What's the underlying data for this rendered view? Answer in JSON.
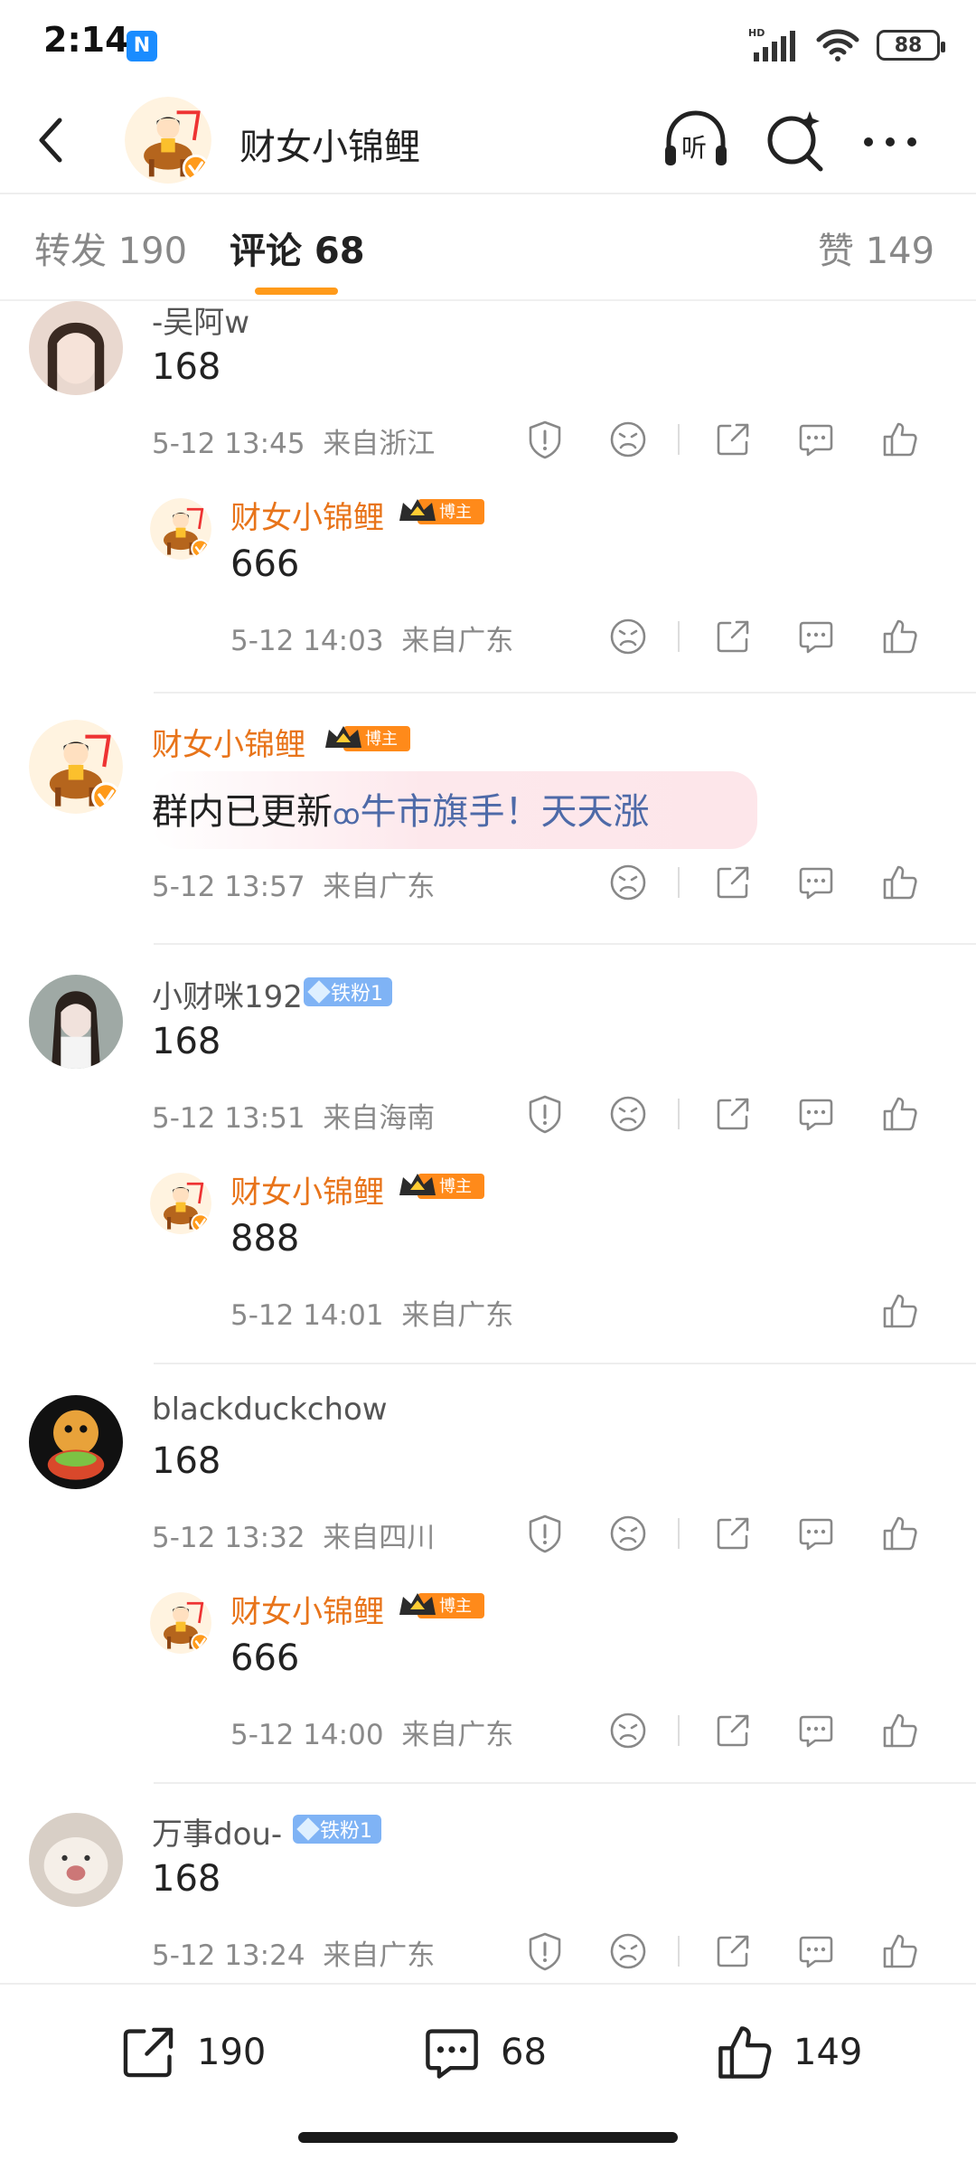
{
  "status_bar": {
    "time": "2:14",
    "battery": "88",
    "hd_label": "HD"
  },
  "header": {
    "title": "财女小锦鲤",
    "listen_label": "听"
  },
  "tabs": [
    {
      "label": "转发 190",
      "active": false
    },
    {
      "label": "评论 68",
      "active": true
    },
    {
      "label": "赞 149",
      "active": false
    }
  ],
  "badges": {
    "blogger": "博主",
    "fan": "铁粉1"
  },
  "comments": [
    {
      "user": "-吴阿w",
      "text": "168",
      "time": "5-12 13:45",
      "location": "来自浙江",
      "reply": {
        "user": "财女小锦鲤",
        "text": "666",
        "time": "5-12 14:03",
        "location": "来自广东"
      }
    },
    {
      "user": "财女小锦鲤",
      "text_prefix": "群内已更新",
      "link_text": "牛市旗手！天天涨",
      "time": "5-12 13:57",
      "location": "来自广东"
    },
    {
      "user": "小财咪192",
      "text": "168",
      "time": "5-12 13:51",
      "location": "来自海南",
      "reply": {
        "user": "财女小锦鲤",
        "text": "888",
        "time": "5-12 14:01",
        "location": "来自广东"
      }
    },
    {
      "user": "blackduckchow",
      "text": "168",
      "time": "5-12 13:32",
      "location": "来自四川",
      "reply": {
        "user": "财女小锦鲤",
        "text": "666",
        "time": "5-12 14:00",
        "location": "来自广东"
      }
    },
    {
      "user": "万事dou-",
      "text": "168",
      "time": "5-12 13:24",
      "location": "来自广东"
    }
  ],
  "bottom_bar": {
    "repost_count": "190",
    "comment_count": "68",
    "like_count": "149"
  },
  "colors": {
    "accent": "#ff9a1a",
    "blogger_name": "#e8741a",
    "fan_badge": "#7fb3f5",
    "link": "#4e6aa8"
  }
}
